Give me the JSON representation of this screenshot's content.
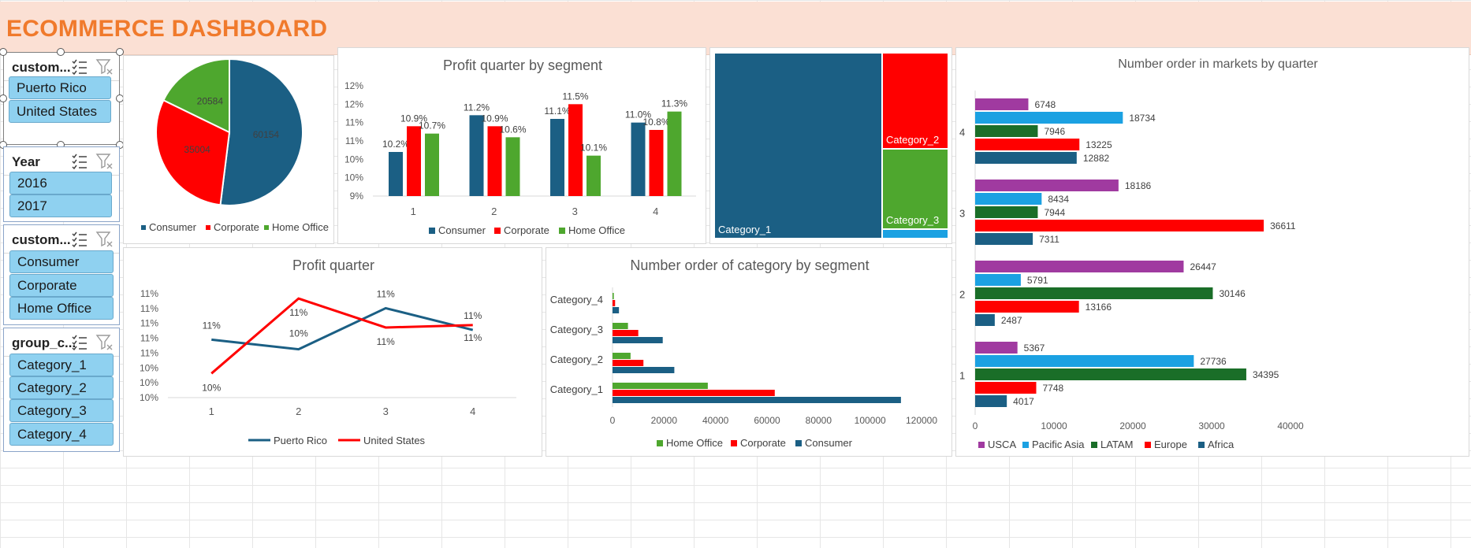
{
  "banner": {
    "title": "ECOMMERCE DASHBOARD"
  },
  "slicers": [
    {
      "title": "custom...",
      "items": [
        "Puerto Rico",
        "United States"
      ]
    },
    {
      "title": "Year",
      "items": [
        "2016",
        "2017"
      ]
    },
    {
      "title": "custom...",
      "items": [
        "Consumer",
        "Corporate",
        "Home Office"
      ]
    },
    {
      "title": "group_c...",
      "items": [
        "Category_1",
        "Category_2",
        "Category_3",
        "Category_4"
      ]
    }
  ],
  "colors": {
    "consumer": "#1b5f84",
    "corporate": "#ff0000",
    "home_office": "#4ea72e",
    "usca": "#a03aa0",
    "pacific_asia": "#1ba1e2",
    "latam": "#1a6e28",
    "europe": "#ff0000",
    "africa": "#1b5f84"
  },
  "icons": {
    "multiselect": "multi-select-icon",
    "clear_filter": "clear-filter-icon"
  },
  "chart_data": [
    {
      "id": "pie",
      "type": "pie",
      "title": "",
      "categories": [
        "Consumer",
        "Corporate",
        "Home Office"
      ],
      "values": [
        60154,
        35004,
        20584
      ],
      "labels": [
        "60154",
        "35004",
        "20584"
      ],
      "legend": "bottom"
    },
    {
      "id": "profit_segment",
      "type": "bar",
      "title": "Profit quarter by segment",
      "categories": [
        "1",
        "2",
        "3",
        "4"
      ],
      "series": [
        {
          "name": "Consumer",
          "values": [
            10.2,
            11.2,
            11.1,
            11.0
          ],
          "labels": [
            "10.2%",
            "11.2%",
            "11.1%",
            "11.0%"
          ]
        },
        {
          "name": "Corporate",
          "values": [
            10.9,
            10.9,
            11.5,
            10.8
          ],
          "labels": [
            "10.9%",
            "10.9%",
            "11.5%",
            "10.8%"
          ]
        },
        {
          "name": "Home Office",
          "values": [
            10.7,
            10.6,
            10.1,
            11.3
          ],
          "labels": [
            "10.7%",
            "10.6%",
            "10.1%",
            "11.3%"
          ]
        }
      ],
      "yticks": [
        "9%",
        "10%",
        "10%",
        "11%",
        "11%",
        "12%",
        "12%"
      ],
      "ylim": [
        9.0,
        12.0
      ],
      "legend": "bottom"
    },
    {
      "id": "treemap",
      "type": "treemap",
      "title": "",
      "categories": [
        "Category_1",
        "Category_2",
        "Category_3",
        "Category_4"
      ],
      "values": [
        112000,
        34000,
        28000,
        3500
      ]
    },
    {
      "id": "markets",
      "type": "bar",
      "orientation": "horizontal",
      "title": "Number order in markets by quarter",
      "categories": [
        "1",
        "2",
        "3",
        "4"
      ],
      "series": [
        {
          "name": "Africa",
          "values": [
            4017,
            2487,
            7311,
            12882
          ]
        },
        {
          "name": "Europe",
          "values": [
            7748,
            13166,
            36611,
            13225
          ]
        },
        {
          "name": "LATAM",
          "values": [
            34395,
            30146,
            7944,
            7946
          ]
        },
        {
          "name": "Pacific Asia",
          "values": [
            27736,
            5791,
            8434,
            18734
          ]
        },
        {
          "name": "USCA",
          "values": [
            5367,
            26447,
            18186,
            6748
          ]
        }
      ],
      "xticks": [
        "0",
        "10000",
        "20000",
        "30000",
        "40000"
      ],
      "xlim": [
        0,
        40000
      ],
      "legend_order": [
        "USCA",
        "Pacific Asia",
        "LATAM",
        "Europe",
        "Africa"
      ],
      "legend": "bottom"
    },
    {
      "id": "profit_quarter",
      "type": "line",
      "title": "Profit quarter",
      "categories": [
        "1",
        "2",
        "3",
        "4"
      ],
      "series": [
        {
          "name": "Puerto Rico",
          "values": [
            10.8,
            10.6,
            11.45,
            11.0
          ],
          "labels": [
            "11%",
            "10%",
            "11%",
            "11%"
          ]
        },
        {
          "name": "United States",
          "values": [
            10.1,
            11.65,
            11.05,
            11.1
          ],
          "labels": [
            "10%",
            "11%",
            "11%",
            "11%"
          ]
        }
      ],
      "yticks": [
        "10%",
        "10%",
        "10%",
        "11%",
        "11%",
        "11%",
        "11%",
        "11%"
      ],
      "ylim": [
        9.6,
        11.75
      ],
      "legend": "bottom"
    },
    {
      "id": "category_segment",
      "type": "bar",
      "orientation": "horizontal",
      "title": "Number order of category by segment",
      "categories": [
        "Category_1",
        "Category_2",
        "Category_3",
        "Category_4"
      ],
      "series": [
        {
          "name": "Consumer",
          "values": [
            112000,
            24000,
            19500,
            2500
          ]
        },
        {
          "name": "Corporate",
          "values": [
            63000,
            12000,
            10000,
            1000
          ]
        },
        {
          "name": "Home Office",
          "values": [
            37000,
            7000,
            6000,
            500
          ]
        }
      ],
      "xticks": [
        "0",
        "20000",
        "40000",
        "60000",
        "80000",
        "100000",
        "120000"
      ],
      "xlim": [
        0,
        120000
      ],
      "legend_order": [
        "Home Office",
        "Corporate",
        "Consumer"
      ],
      "legend": "bottom"
    }
  ]
}
